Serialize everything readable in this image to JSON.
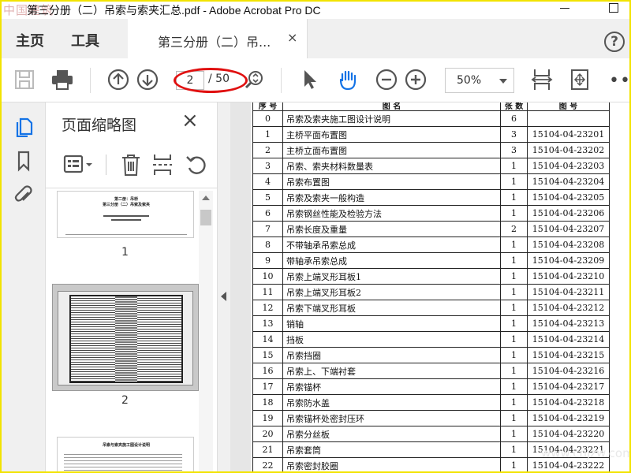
{
  "window": {
    "title": "第三分册（二）吊索与索夹汇总.pdf - Adobe Acrobat Pro DC",
    "watermark": "中国建筑"
  },
  "menu": {
    "home": "主页",
    "tools": "工具"
  },
  "doc_tab": {
    "label": "第三分册（二）吊...",
    "close": "×"
  },
  "toolbar": {
    "current_page": "2",
    "total_pages": "/ 50",
    "zoom": "50%",
    "more": "•••"
  },
  "panel": {
    "title": "页面缩略图",
    "close": "×",
    "thumbnails": [
      {
        "num": "1",
        "title": "第二册：吊桥",
        "subtitle": "第三分册（二）吊索及索夹"
      },
      {
        "num": "2"
      },
      {
        "num": "",
        "title": "吊索与索夹施工图设计说明"
      }
    ]
  },
  "table": {
    "header": [
      "序 号",
      "图 名",
      "张 数",
      "图 号"
    ],
    "rows": [
      [
        "0",
        "吊索及索夹施工图设计说明",
        "6",
        ""
      ],
      [
        "1",
        "主桥平面布置图",
        "3",
        "15104-04-23201"
      ],
      [
        "2",
        "主桥立面布置图",
        "3",
        "15104-04-23202"
      ],
      [
        "3",
        "吊索、索夹材料数量表",
        "1",
        "15104-04-23203"
      ],
      [
        "4",
        "吊索布置图",
        "1",
        "15104-04-23204"
      ],
      [
        "5",
        "吊索及索夹一般构造",
        "1",
        "15104-04-23205"
      ],
      [
        "6",
        "吊索钢丝性能及检验方法",
        "1",
        "15104-04-23206"
      ],
      [
        "7",
        "吊索长度及重量",
        "2",
        "15104-04-23207"
      ],
      [
        "8",
        "不带轴承吊索总成",
        "1",
        "15104-04-23208"
      ],
      [
        "9",
        "带轴承吊索总成",
        "1",
        "15104-04-23209"
      ],
      [
        "10",
        "吊索上端叉形耳板1",
        "1",
        "15104-04-23210"
      ],
      [
        "11",
        "吊索上端叉形耳板2",
        "1",
        "15104-04-23211"
      ],
      [
        "12",
        "吊索下端叉形耳板",
        "1",
        "15104-04-23212"
      ],
      [
        "13",
        "销轴",
        "1",
        "15104-04-23213"
      ],
      [
        "14",
        "挡板",
        "1",
        "15104-04-23214"
      ],
      [
        "15",
        "吊索挡圈",
        "1",
        "15104-04-23215"
      ],
      [
        "16",
        "吊索上、下端衬套",
        "1",
        "15104-04-23216"
      ],
      [
        "17",
        "吊索锚杯",
        "1",
        "15104-04-23217"
      ],
      [
        "18",
        "吊索防水盖",
        "1",
        "15104-04-23218"
      ],
      [
        "19",
        "吊索锚杯处密封压环",
        "1",
        "15104-04-23219"
      ],
      [
        "20",
        "吊索分丝板",
        "1",
        "15104-04-23220"
      ],
      [
        "21",
        "吊索套筒",
        "1",
        "15104-04-23221"
      ],
      [
        "22",
        "吊索密封胶圈",
        "1",
        "15104-04-23222"
      ]
    ]
  },
  "corner_watermark": "www.cnjzw.com"
}
